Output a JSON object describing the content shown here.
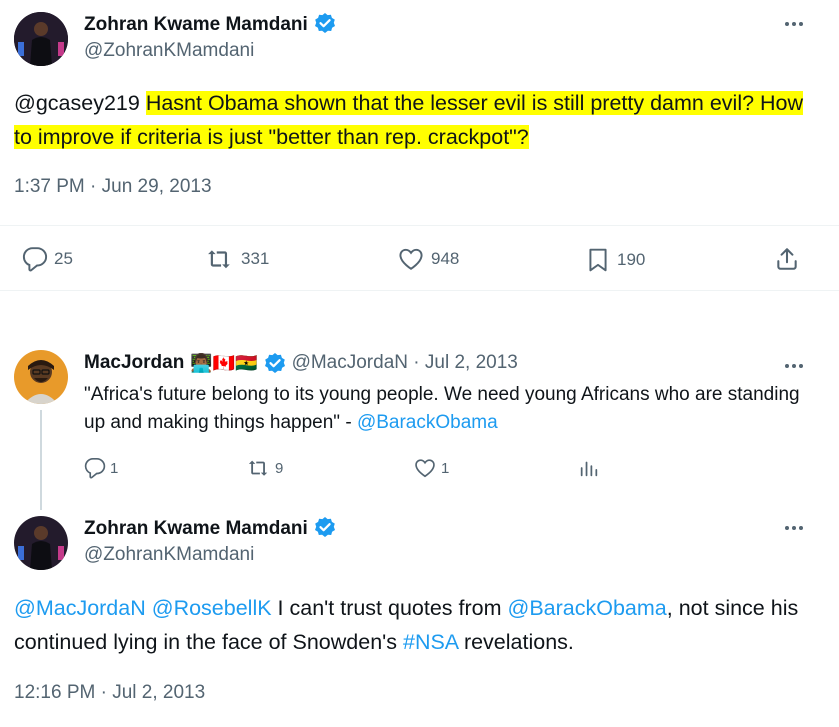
{
  "tweet1": {
    "name": "Zohran Kwame Mamdani",
    "handle": "@ZohranKMamdani",
    "mention": "@gcasey219",
    "text": "Hasnt Obama shown that the lesser evil is still pretty damn evil? How to improve if criteria is just \"better than rep. crackpot\"?",
    "timestamp": "1:37 PM · Jun 29, 2013",
    "replies": "25",
    "retweets": "331",
    "likes": "948",
    "bookmarks": "190"
  },
  "tweet2": {
    "name": "MacJordan",
    "emoji": "👨🏾‍💻🇨🇦🇬🇭",
    "handle_date": "@MacJordaN · Jul 2, 2013",
    "text": "\"Africa's future belong to its young people. We need young Africans who are standing up and making things happen\" - ",
    "link": "@BarackObama",
    "replies": "1",
    "retweets": "9",
    "likes": "1"
  },
  "tweet3": {
    "name": "Zohran Kwame Mamdani",
    "handle": "@ZohranKMamdani",
    "mention1": "@MacJordaN",
    "mention2": "@RosebellK",
    "text_a": " I can't trust quotes from ",
    "mention3": "@BarackObama",
    "text_b": ", not since his continued lying in the face of Snowden's ",
    "hashtag": "#NSA",
    "text_c": " revelations.",
    "timestamp": "12:16 PM · Jul 2, 2013"
  },
  "colors": {
    "accent": "#1d9bf0",
    "highlight": "#ffff00",
    "muted": "#536471"
  },
  "icons": [
    "verified-icon",
    "more-icon",
    "reply-icon",
    "retweet-icon",
    "like-icon",
    "bookmark-icon",
    "share-icon",
    "views-icon"
  ]
}
